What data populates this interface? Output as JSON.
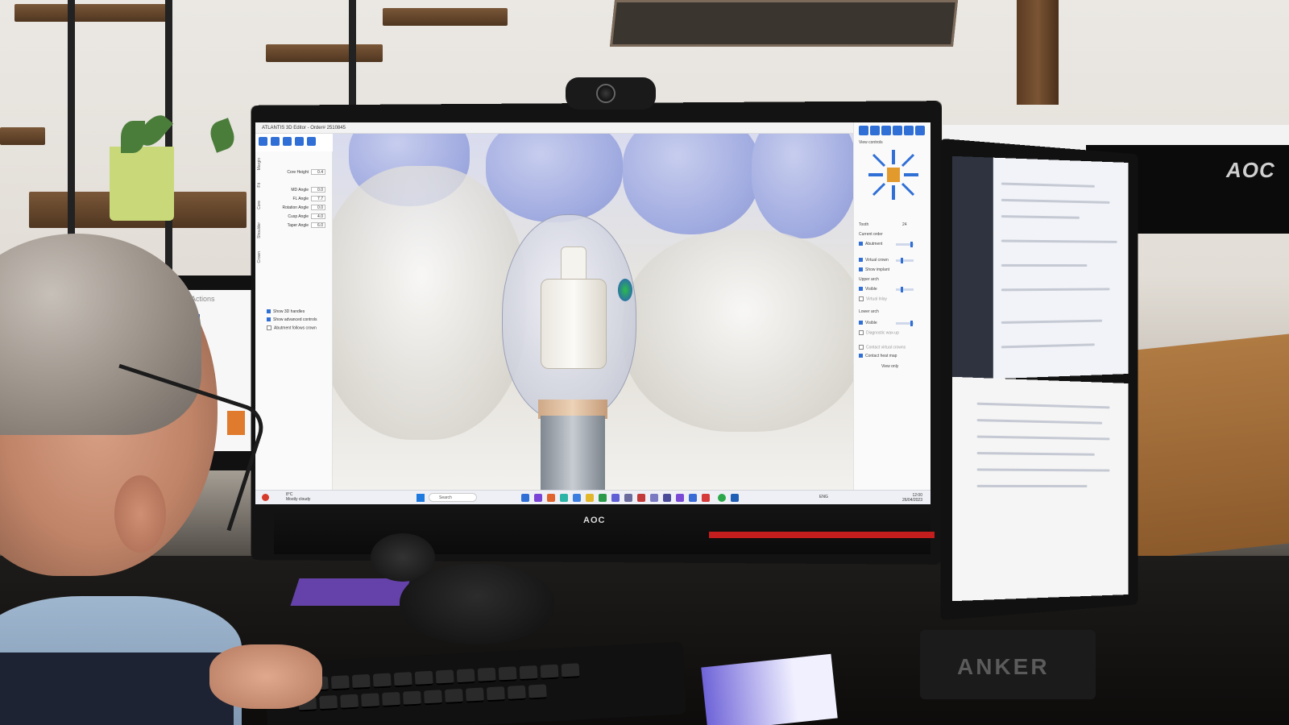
{
  "main_monitor": {
    "brand": "AOC",
    "app": {
      "window_title": "ATLANTIS 3D Editor - Order# 2510845",
      "left_panel": {
        "tabs": [
          "Margin",
          "Fit",
          "Core",
          "Shoulder",
          "Crown"
        ],
        "params": [
          {
            "label": "Core Height",
            "value": "0.4"
          },
          {
            "label": "MD Angle",
            "value": "0.0"
          },
          {
            "label": "FL Angle",
            "value": "7.7"
          },
          {
            "label": "Rotation Angle",
            "value": "0.0"
          },
          {
            "label": "Cusp Angle",
            "value": "4.0"
          },
          {
            "label": "Taper Angle",
            "value": "6.0"
          }
        ],
        "options": [
          {
            "label": "Show 3D handles",
            "checked": true
          },
          {
            "label": "Show advanced controls",
            "checked": true
          },
          {
            "label": "Abutment follows crown",
            "checked": false
          }
        ]
      },
      "right_panel": {
        "view_controls_label": "View controls",
        "tooth_label": "Tooth",
        "tooth_value": "24",
        "current_order_label": "Current order",
        "items": [
          {
            "label": "Abutment",
            "checked": true
          },
          {
            "label": "Virtual crown",
            "checked": true
          },
          {
            "label": "Show implant",
            "checked": true
          },
          {
            "label": "Upper arch",
            "checked": null
          },
          {
            "label": "Visible",
            "checked": true
          },
          {
            "label": "Virtual Inlay",
            "checked": false
          },
          {
            "label": "Lower arch",
            "checked": null
          },
          {
            "label": "Visible",
            "checked": true
          },
          {
            "label": "Diagnostic wax-up",
            "checked": false
          },
          {
            "label": "Contact virtual crowns",
            "checked": false
          },
          {
            "label": "Contact heat map",
            "checked": true
          }
        ],
        "view_button": "View only"
      },
      "taskbar": {
        "weather_temp": "8°C",
        "weather_desc": "Mostly cloudy",
        "search_placeholder": "Search",
        "clock_time": "12:00",
        "clock_date": "26/04/2023",
        "lang": "ENG"
      }
    }
  },
  "left_monitor": {
    "title": "Actions"
  },
  "desk": {
    "speaker_brand": "ANKER",
    "rear_monitor_brand": "AOC"
  },
  "colors": {
    "accent_blue": "#2f6fd6",
    "tooth_blue": "#9ea9df",
    "monitor_red": "#c31d1d"
  }
}
